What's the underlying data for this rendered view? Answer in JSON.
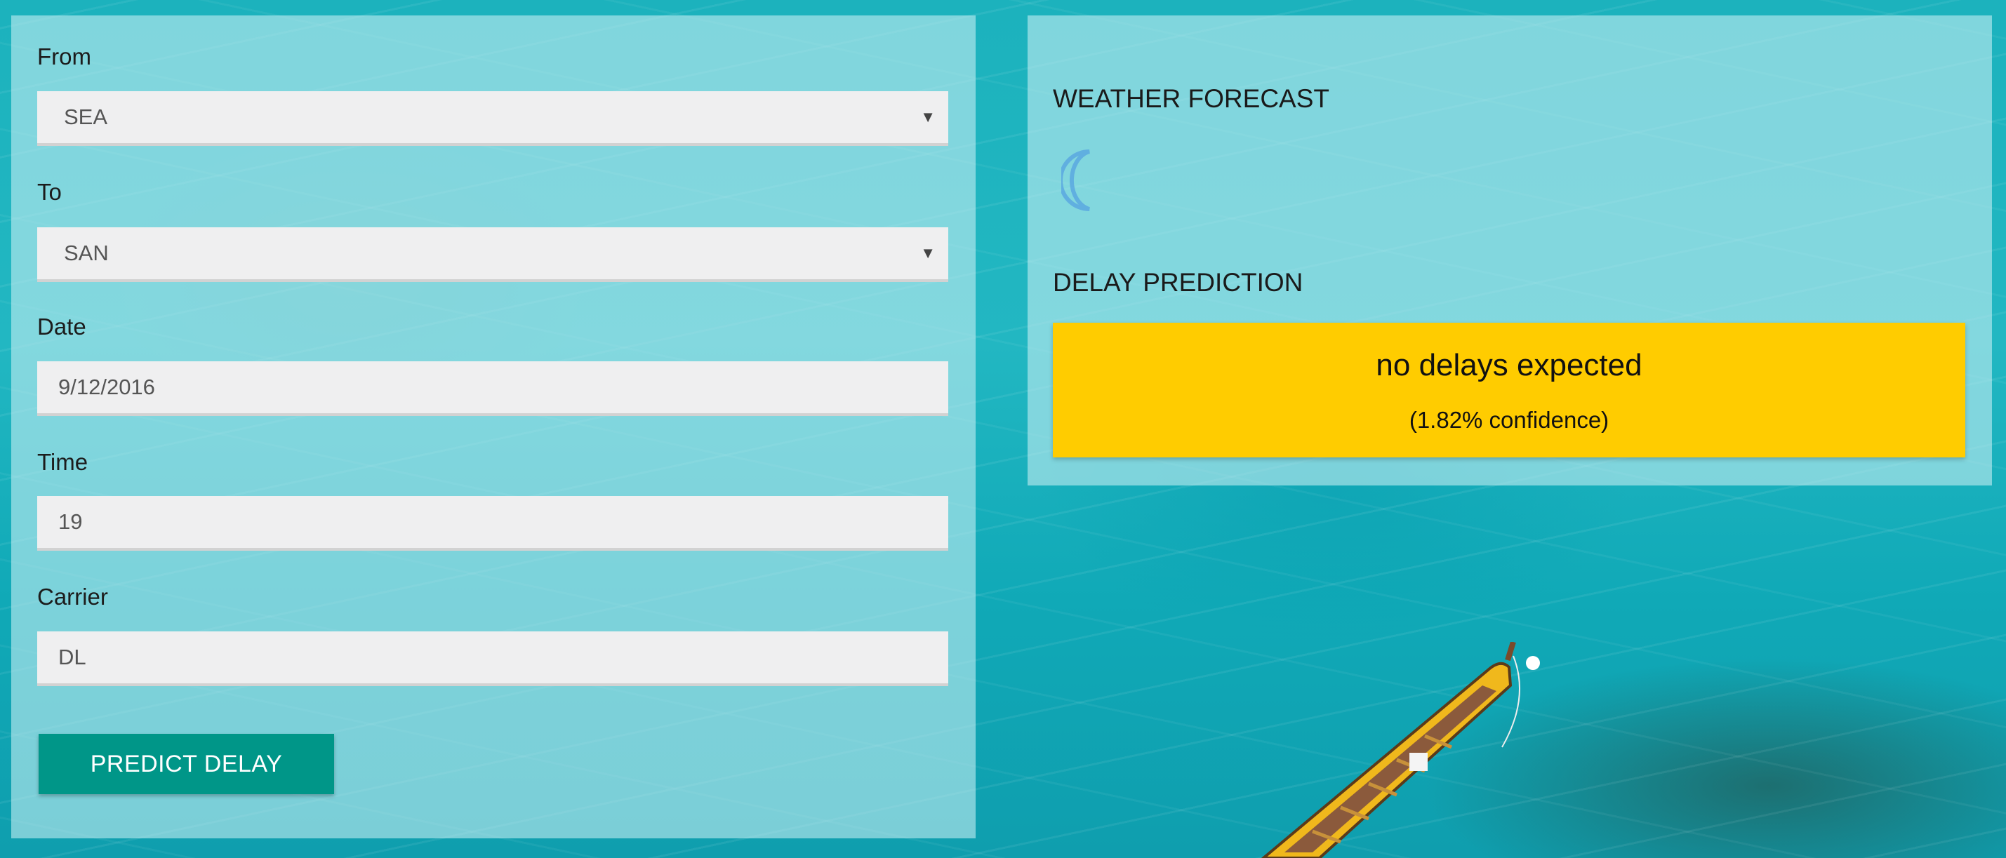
{
  "form": {
    "from_label": "From",
    "from_value": "SEA",
    "to_label": "To",
    "to_value": "SAN",
    "date_label": "Date",
    "date_value": "9/12/2016",
    "time_label": "Time",
    "time_value": "19",
    "carrier_label": "Carrier",
    "carrier_value": "DL",
    "submit_label": "PREDICT DELAY"
  },
  "weather": {
    "title": "WEATHER FORECAST",
    "icon": "crescent-moon-icon"
  },
  "prediction": {
    "title": "DELAY PREDICTION",
    "result": "no delays expected",
    "confidence": "(1.82% confidence)",
    "box_color": "#ffcc00"
  },
  "colors": {
    "accent": "#009688",
    "icon": "#5aa8e0"
  }
}
